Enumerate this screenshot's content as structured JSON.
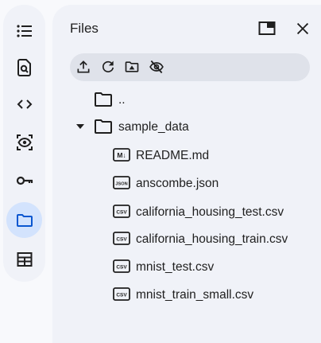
{
  "rail": {
    "items": [
      {
        "name": "table-of-contents-icon",
        "active": false
      },
      {
        "name": "find-replace-icon",
        "active": false
      },
      {
        "name": "code-snippets-icon",
        "active": false
      },
      {
        "name": "variables-eye-icon",
        "active": false
      },
      {
        "name": "secrets-key-icon",
        "active": false
      },
      {
        "name": "files-folder-icon",
        "active": true
      },
      {
        "name": "data-table-icon",
        "active": false
      }
    ]
  },
  "panel": {
    "title": "Files",
    "toolbar_icons": [
      "upload-icon",
      "refresh-icon",
      "mount-drive-icon",
      "hide-hidden-files-icon"
    ]
  },
  "files": {
    "parent": "..",
    "folder": "sample_data",
    "items": [
      {
        "name": "README.md",
        "icon": "markdown-file-icon",
        "badge": "M↓"
      },
      {
        "name": "anscombe.json",
        "icon": "json-file-icon",
        "badge": "JSON"
      },
      {
        "name": "california_housing_test.csv",
        "icon": "csv-file-icon",
        "badge": "CSV"
      },
      {
        "name": "california_housing_train.csv",
        "icon": "csv-file-icon",
        "badge": "CSV"
      },
      {
        "name": "mnist_test.csv",
        "icon": "csv-file-icon",
        "badge": "CSV"
      },
      {
        "name": "mnist_train_small.csv",
        "icon": "csv-file-icon",
        "badge": "CSV"
      }
    ]
  },
  "colors": {
    "accent": "#d3e3fd",
    "panel_bg": "#f0f2f8",
    "toolbar_bg": "#dfe2ea",
    "icon": "#1f1f1f"
  }
}
